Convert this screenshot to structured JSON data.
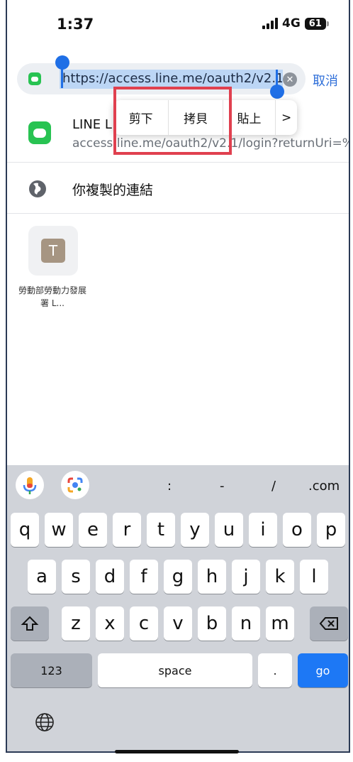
{
  "status": {
    "time": "1:37",
    "network": "4G",
    "battery": "61"
  },
  "url_bar": {
    "url": "https://access.line.me/oauth2/v2.1/l",
    "cancel_label": "取消"
  },
  "context_menu": {
    "items": [
      "剪下",
      "拷貝",
      "貼上",
      ">"
    ]
  },
  "suggestion": {
    "title": "LINE L",
    "url": "access.line.me/oauth2/v2.1/login?returnUri=%"
  },
  "copied_link": {
    "label": "你複製的連結"
  },
  "shortcut": {
    "letter": "T",
    "name": "勞動部勞動力發展署 L..."
  },
  "keyboard": {
    "shortcuts": [
      ":",
      "-",
      "/",
      ".com"
    ],
    "row1": [
      "q",
      "w",
      "e",
      "r",
      "t",
      "y",
      "u",
      "i",
      "o",
      "p"
    ],
    "row2": [
      "a",
      "s",
      "d",
      "f",
      "g",
      "h",
      "j",
      "k",
      "l"
    ],
    "row3": [
      "z",
      "x",
      "c",
      "v",
      "b",
      "n",
      "m"
    ],
    "num_label": "123",
    "space_label": "space",
    "period_label": ".",
    "go_label": "go"
  },
  "colors": {
    "accent": "#1f6fe6",
    "highlight_box": "#e0404f",
    "line_green": "#28c352"
  }
}
